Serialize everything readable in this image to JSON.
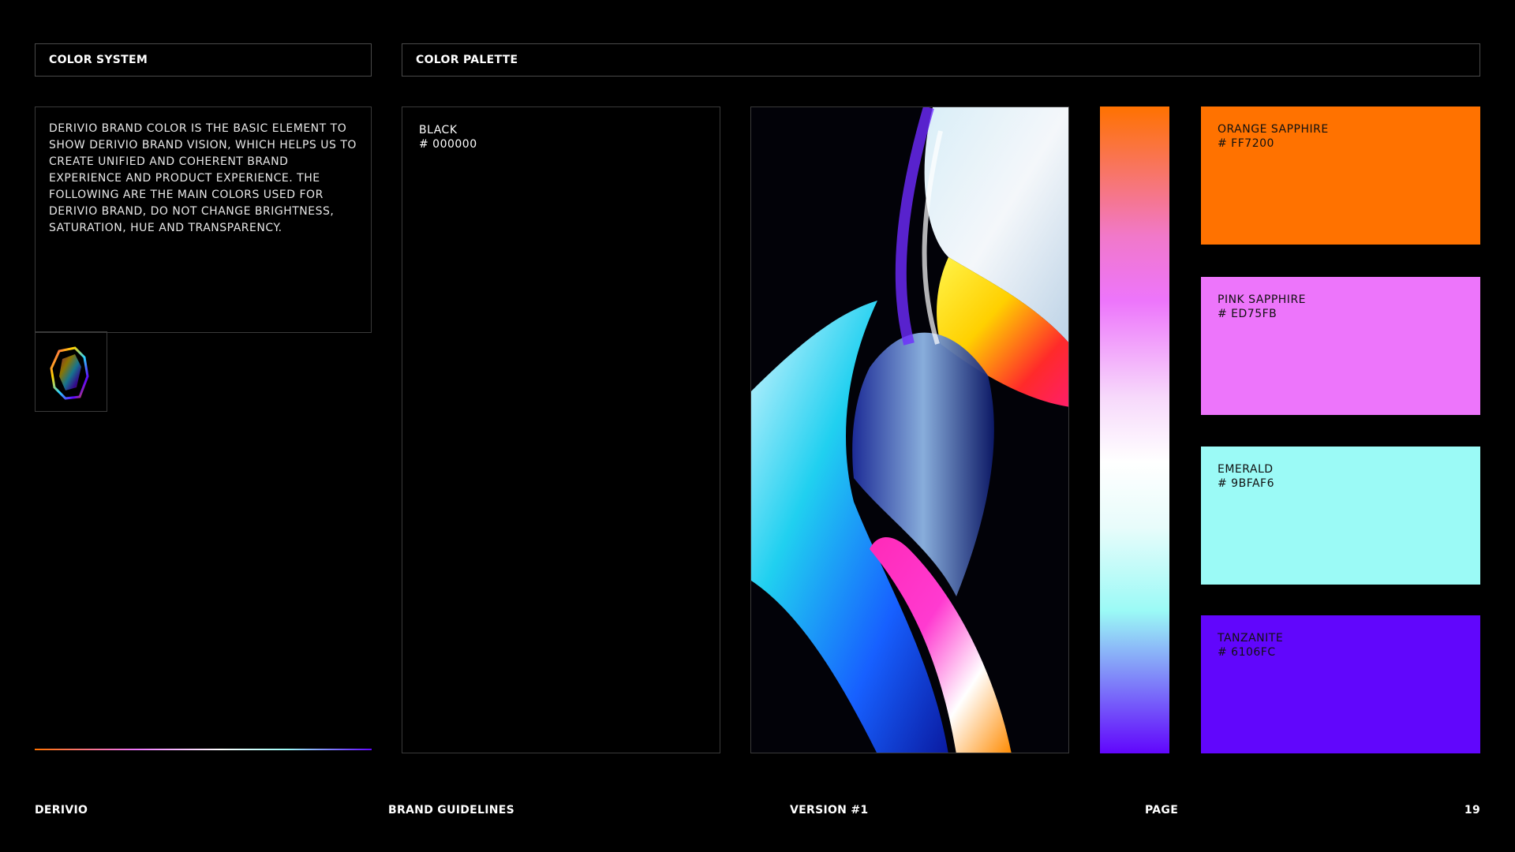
{
  "header": {
    "left_title": "COLOR SYSTEM",
    "right_title": "COLOR PALETTE"
  },
  "description": "DERIVIO BRAND COLOR IS THE BASIC ELEMENT TO SHOW DERIVIO BRAND VISION, WHICH HELPS US TO CREATE UNIFIED AND COHERENT BRAND EXPERIENCE AND PRODUCT EXPERIENCE. THE FOLLOWING ARE THE MAIN COLORS USED FOR DERIVIO BRAND, DO NOT CHANGE BRIGHTNESS, SATURATION, HUE AND TRANSPARENCY.",
  "black_swatch": {
    "name": "BLACK",
    "code": "# 000000",
    "color": "#000000"
  },
  "swatches": [
    {
      "name": "ORANGE SAPPHIRE",
      "code": "# FF7200",
      "color": "#FF7200"
    },
    {
      "name": "PINK SAPPHIRE",
      "code": "# ED75FB",
      "color": "#ED75FB"
    },
    {
      "name": "EMERALD",
      "code": "# 9BFAF6",
      "color": "#9BFAF6"
    },
    {
      "name": "TANZANITE",
      "code": "# 6106FC",
      "color": "#6106FC"
    }
  ],
  "footer": {
    "brand": "DERIVIO",
    "doc": "BRAND GUIDELINES",
    "version": "VERSION #1",
    "page_label": "PAGE",
    "page_number": "19"
  }
}
